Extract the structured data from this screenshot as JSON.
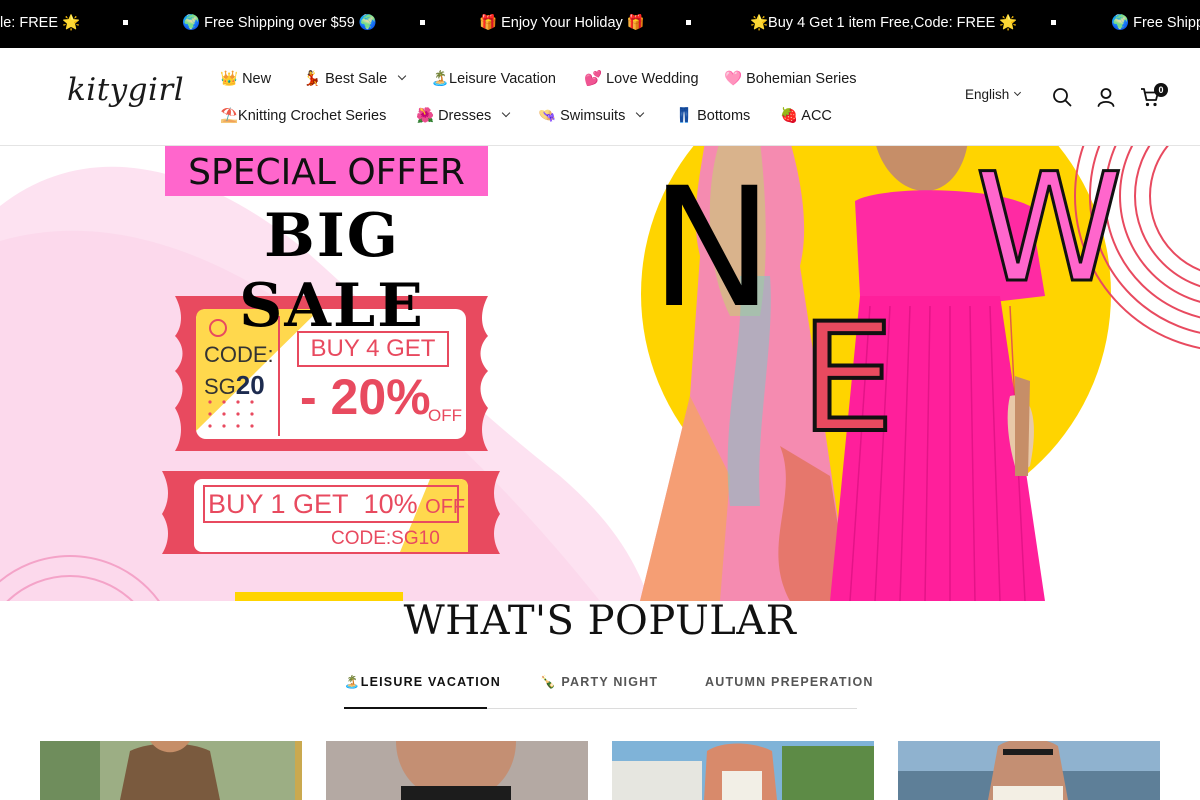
{
  "announcements": [
    "le: FREE 🌟",
    "🌍 Free Shipping over $59 🌍",
    "🎁 Enjoy Your Holiday 🎁",
    "🌟Buy 4 Get 1 item Free,Code: FREE 🌟",
    "🌍 Free Shipping over $59 🌍"
  ],
  "header": {
    "logo": "kitygirl",
    "nav": [
      {
        "label": "👑 New",
        "dropdown": false
      },
      {
        "label": "💃 Best Sale",
        "dropdown": true
      },
      {
        "label": "🏝️Leisure Vacation",
        "dropdown": false
      },
      {
        "label": "💕 Love Wedding",
        "dropdown": false
      },
      {
        "label": "🩷 Bohemian Series",
        "dropdown": false
      },
      {
        "label": "⛱️Knitting Crochet Series",
        "dropdown": false
      },
      {
        "label": "🌺 Dresses",
        "dropdown": true
      },
      {
        "label": "👒 Swimsuits",
        "dropdown": true
      },
      {
        "label": "👖 Bottoms",
        "dropdown": false
      },
      {
        "label": "🍓 ACC",
        "dropdown": false
      }
    ],
    "language": "English",
    "cart_count": "0",
    "icons": [
      "search-icon",
      "account-icon",
      "cart-icon"
    ]
  },
  "hero": {
    "special_offer": "SPECIAL OFFER",
    "big_sale": "BIG SALE",
    "coupon1_code_label": "CODE:",
    "coupon1_code_prefix": "SG",
    "coupon1_code_number": "20",
    "coupon1_offer": "BUY 4 GET",
    "coupon1_discount": "- 20%",
    "coupon1_off": "OFF",
    "coupon2_offer_a": "BUY 1 GET",
    "coupon2_offer_b": "10%",
    "coupon2_off": "OFF",
    "coupon2_code": "CODE:SG10",
    "new_letters": [
      "N",
      "E",
      "W"
    ],
    "colors": {
      "pink": "#ff66cc",
      "coupon_red": "#e84a5f",
      "yellow": "#ffd400",
      "magenta_dress": "#ff1f9b"
    }
  },
  "popular": {
    "title": "WHAT'S POPULAR",
    "tabs": [
      "🏝️LEISURE VACATION",
      "🍾 PARTY NIGHT",
      "AUTUMN PREPERATION"
    ],
    "active_tab": 0
  }
}
